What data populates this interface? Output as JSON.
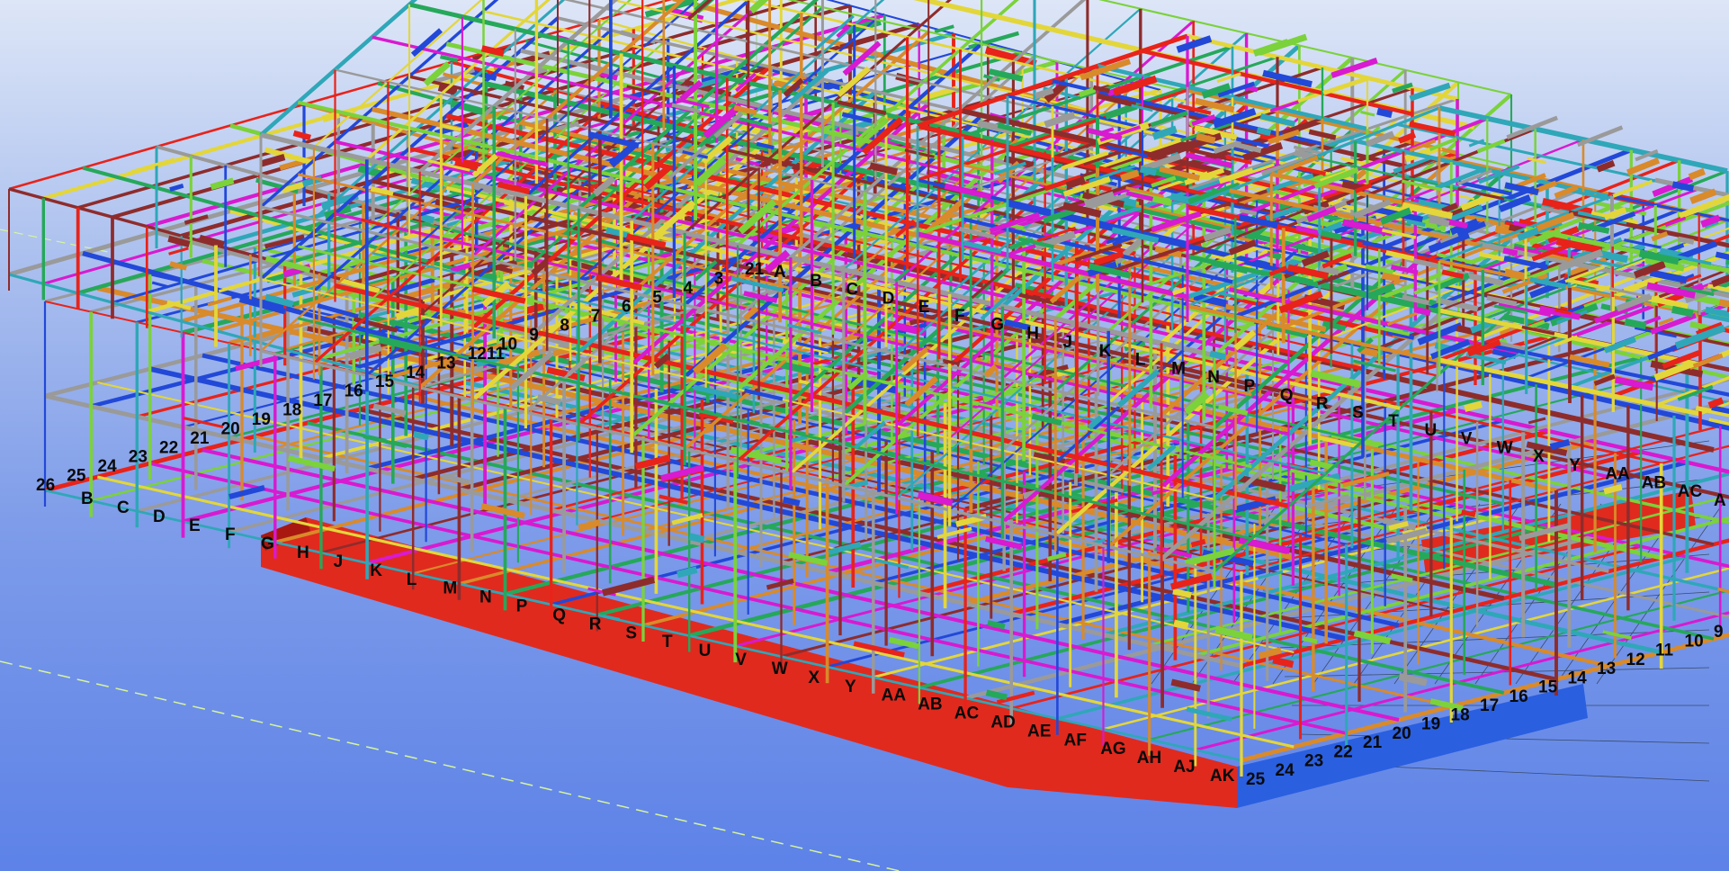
{
  "viewport": {
    "background_top": "#dde6f7",
    "background_bottom": "#5d82e8",
    "member_colors": [
      "#e8231a",
      "#2248d8",
      "#7bd23a",
      "#d81ad0",
      "#e3d63a",
      "#2fa7b8",
      "#d98a2a",
      "#9a9a9a",
      "#8e2c2c",
      "#26a85a"
    ],
    "slab_color": "#e02a1e",
    "slab_blue": "#2a5fe0"
  },
  "grid_labels": {
    "top_numbers": [
      "21",
      "3",
      "4",
      "5",
      "6",
      "7",
      "8",
      "9",
      "10",
      "1211",
      "13",
      "14",
      "15",
      "16",
      "17",
      "18",
      "19",
      "20",
      "21",
      "22",
      "23",
      "24",
      "25",
      "26"
    ],
    "top_letters": [
      "A",
      "B",
      "C",
      "D",
      "E",
      "F",
      "G",
      "H",
      "J",
      "K",
      "L",
      "M",
      "N",
      "P",
      "Q",
      "R",
      "S",
      "T",
      "U",
      "V",
      "W",
      "X",
      "Y",
      "AA",
      "AB",
      "AC",
      "A"
    ],
    "left_letters": [
      "B",
      "C",
      "D",
      "E",
      "F",
      "G"
    ],
    "front_letters": [
      "H",
      "J",
      "K",
      "L",
      "M",
      "N",
      "P",
      "Q",
      "R",
      "S",
      "T",
      "U",
      "V",
      "W",
      "X",
      "Y",
      "AA",
      "AB",
      "AC",
      "AD",
      "AE",
      "AF",
      "AG",
      "AH",
      "AJ",
      "AK"
    ],
    "front_numbers": [
      "25",
      "24",
      "23",
      "22",
      "21",
      "20",
      "19",
      "18",
      "17",
      "16",
      "15",
      "14",
      "13",
      "12",
      "11",
      "10",
      "9"
    ]
  }
}
